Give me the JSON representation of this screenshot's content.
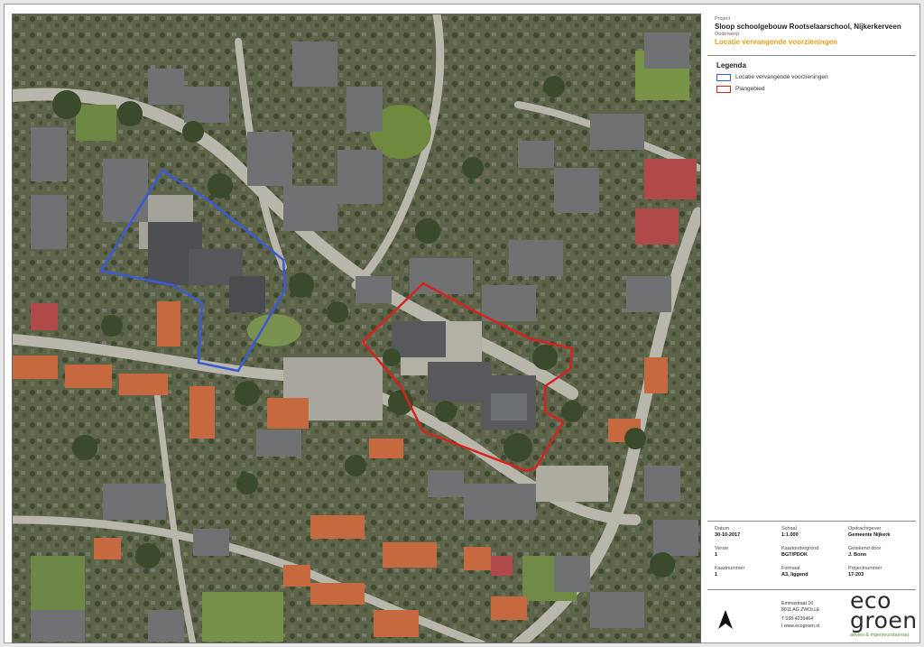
{
  "title_block": {
    "project_label": "Project",
    "project_title": "Sloop schoolgebouw Rootselaarschool, Nijkerkerveen",
    "subject_label": "Onderwerp",
    "subject": "Locatie vervangende voorzieningen"
  },
  "legend": {
    "title": "Legenda",
    "items": [
      {
        "label": "Locatie vervangende voorzieningen",
        "color": "#3a5ad8"
      },
      {
        "label": "Plangebied",
        "color": "#d42420"
      }
    ]
  },
  "metadata": {
    "datum_label": "Datum",
    "datum": "30-10-2017",
    "schaal_label": "Schaal",
    "schaal": "1:1.000",
    "opdrachtgever_label": "Opdrachtgever",
    "opdrachtgever": "Gemeente Nijkerk",
    "versie_label": "Versie",
    "versie": "1",
    "kaartondergrond_label": "Kaartondergrond",
    "kaartondergrond": "BGT/PDOK",
    "getekend_label": "Getekend door",
    "getekend": "J. Bonn",
    "kaartnummer_label": "Kaartnummer",
    "kaartnummer": "1",
    "formaat_label": "Formaat",
    "formaat": "A3, liggend",
    "projectnummer_label": "Projectnummer",
    "projectnummer": "17-203"
  },
  "address": {
    "line1": "Emmastraat 16",
    "line2": "8011 AG ZWOLLE",
    "line3": "T 038-4235464",
    "line4": "I www.ecogroen.nl"
  },
  "logo": {
    "line1": "eco",
    "line2": "groen",
    "tagline": "advies & ingenieursbureau",
    "accent": "#3aa14a"
  },
  "map": {
    "outline_blue": "#3a5ad8",
    "outline_red": "#d42420",
    "north_arrow": "north-arrow-icon"
  }
}
